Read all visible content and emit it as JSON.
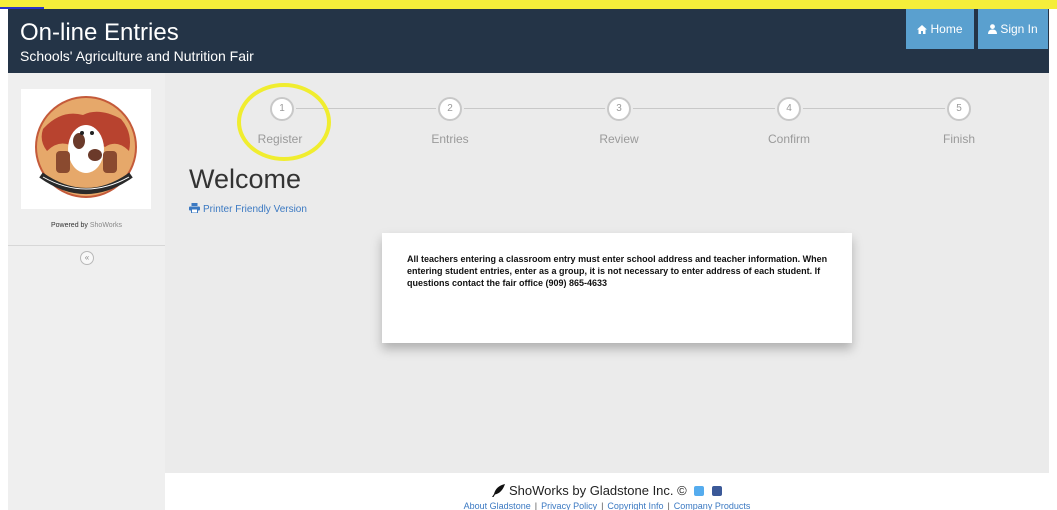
{
  "header": {
    "title": "On-line Entries",
    "subtitle": "Schools' Agriculture and Nutrition Fair",
    "home_label": "Home",
    "signin_label": "Sign In"
  },
  "sidebar": {
    "powered_prefix": "Powered by",
    "powered_brand": "ShoWorks",
    "collapse_glyph": "«",
    "logo_icon": "get-your-mooove-on-logo"
  },
  "wizard": {
    "steps": [
      {
        "number": "1",
        "label": "Register"
      },
      {
        "number": "2",
        "label": "Entries"
      },
      {
        "number": "3",
        "label": "Review"
      },
      {
        "number": "4",
        "label": "Confirm"
      },
      {
        "number": "5",
        "label": "Finish"
      }
    ]
  },
  "main": {
    "welcome": "Welcome",
    "printer_link": "Printer Friendly Version",
    "notice": "All teachers entering a classroom entry must enter school address and teacher information.  When entering student entries, enter as a group, it is not necessary to enter address of each student.  If questions contact the fair office (909) 865-4633"
  },
  "footer": {
    "brand": "ShoWorks by Gladstone Inc. ©",
    "links": [
      "About Gladstone",
      "Privacy Policy",
      "Copyright Info",
      "Company Products"
    ]
  },
  "colors": {
    "header_bg": "#243447",
    "nav_button": "#5aa0cf",
    "link": "#3b79c2",
    "highlight": "#f0ed2f"
  }
}
